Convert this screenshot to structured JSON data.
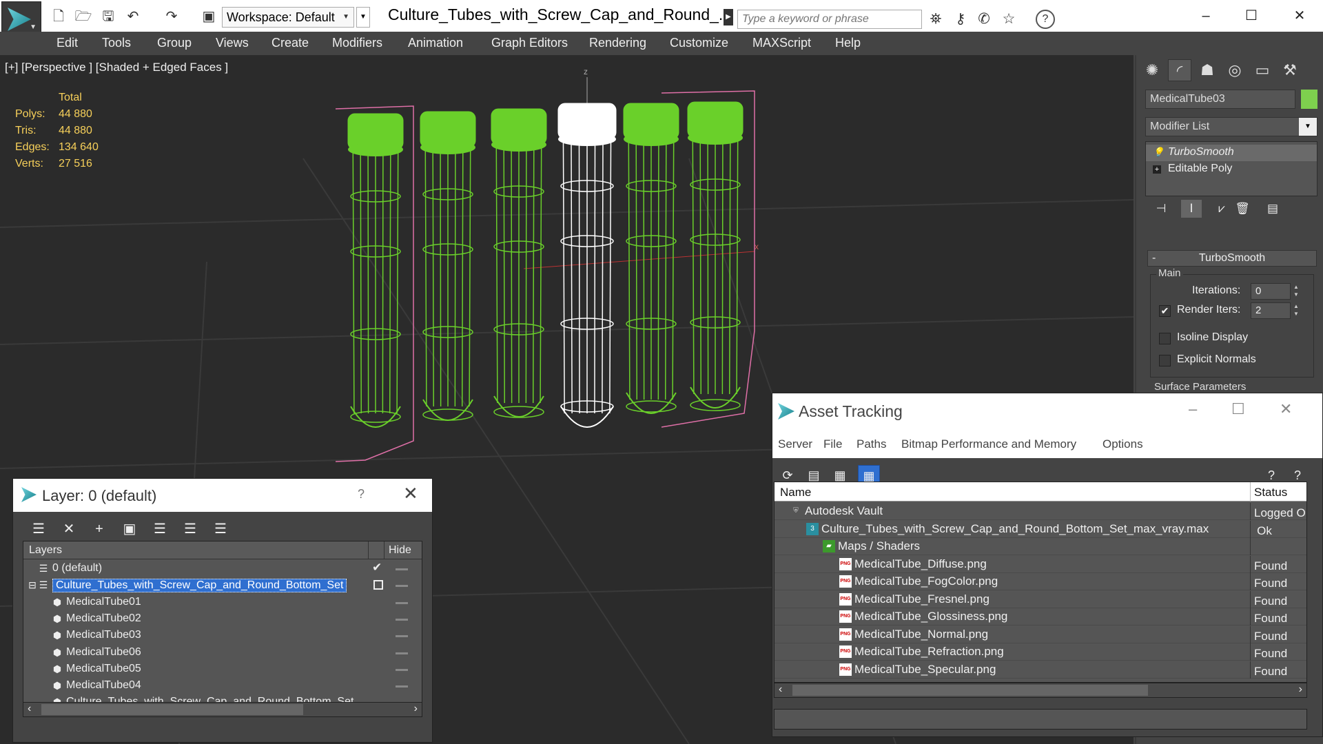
{
  "titlebar": {
    "workspace_label": "Workspace: Default",
    "document_title": "Culture_Tubes_with_Screw_Cap_and_Round_...",
    "search_placeholder": "Type a keyword or phrase"
  },
  "menu": [
    "Edit",
    "Tools",
    "Group",
    "Views",
    "Create",
    "Modifiers",
    "Animation",
    "Graph Editors",
    "Rendering",
    "Customize",
    "MAXScript",
    "Help"
  ],
  "viewport": {
    "label": "[+] [Perspective ] [Shaded + Edged Faces ]",
    "stats": {
      "header": "Total",
      "rows": [
        {
          "key": "Polys:",
          "value": "44 880"
        },
        {
          "key": "Tris:",
          "value": "44 880"
        },
        {
          "key": "Edges:",
          "value": "134 640"
        },
        {
          "key": "Verts:",
          "value": "27 516"
        }
      ]
    },
    "axis_labels": {
      "z": "z",
      "x": "x"
    },
    "colors": {
      "tube": "#6ad02a",
      "selected_tube": "#ffffff",
      "bbox": "#e070a8"
    }
  },
  "command_panel": {
    "object_name": "MedicalTube03",
    "object_color": "#7ed04e",
    "modifier_list": "Modifier List",
    "stack": [
      "TurboSmooth",
      "Editable Poly"
    ],
    "rollout_title": "TurboSmooth",
    "main_group": "Main",
    "iterations_label": "Iterations:",
    "iterations_value": "0",
    "render_iters_label": "Render Iters:",
    "render_iters_value": "2",
    "render_iters_checked": true,
    "isoline_label": "Isoline Display",
    "explicit_normals_label": "Explicit Normals",
    "surface_params": "Surface Parameters"
  },
  "layer_window": {
    "title": "Layer: 0 (default)",
    "help": "?",
    "col_layers": "Layers",
    "col_hide": "Hide",
    "rows": [
      {
        "name": "0 (default)",
        "level": 0,
        "type": "layer"
      },
      {
        "name": "Culture_Tubes_with_Screw_Cap_and_Round_Bottom_Set",
        "level": 0,
        "type": "layer",
        "selected": true
      },
      {
        "name": "MedicalTube01",
        "level": 1,
        "type": "object"
      },
      {
        "name": "MedicalTube02",
        "level": 1,
        "type": "object"
      },
      {
        "name": "MedicalTube03",
        "level": 1,
        "type": "object"
      },
      {
        "name": "MedicalTube06",
        "level": 1,
        "type": "object"
      },
      {
        "name": "MedicalTube05",
        "level": 1,
        "type": "object"
      },
      {
        "name": "MedicalTube04",
        "level": 1,
        "type": "object"
      },
      {
        "name": "Culture_Tubes_with_Screw_Cap_and_Round_Bottom_Set",
        "level": 1,
        "type": "object"
      }
    ]
  },
  "asset_window": {
    "title": "Asset Tracking",
    "menu": [
      "Server",
      "File",
      "Paths",
      "Bitmap Performance and Memory",
      "Options"
    ],
    "col_name": "Name",
    "col_status": "Status",
    "rows": [
      {
        "name": "Autodesk Vault",
        "status": "Logged O",
        "level": 0,
        "icon": "vault"
      },
      {
        "name": "Culture_Tubes_with_Screw_Cap_and_Round_Bottom_Set_max_vray.max",
        "status": "Ok",
        "level": 1,
        "icon": "max"
      },
      {
        "name": "Maps / Shaders",
        "status": "",
        "level": 2,
        "icon": "maps"
      },
      {
        "name": "MedicalTube_Diffuse.png",
        "status": "Found",
        "level": 3,
        "icon": "png"
      },
      {
        "name": "MedicalTube_FogColor.png",
        "status": "Found",
        "level": 3,
        "icon": "png"
      },
      {
        "name": "MedicalTube_Fresnel.png",
        "status": "Found",
        "level": 3,
        "icon": "png"
      },
      {
        "name": "MedicalTube_Glossiness.png",
        "status": "Found",
        "level": 3,
        "icon": "png"
      },
      {
        "name": "MedicalTube_Normal.png",
        "status": "Found",
        "level": 3,
        "icon": "png"
      },
      {
        "name": "MedicalTube_Refraction.png",
        "status": "Found",
        "level": 3,
        "icon": "png"
      },
      {
        "name": "MedicalTube_Specular.png",
        "status": "Found",
        "level": 3,
        "icon": "png"
      }
    ]
  }
}
